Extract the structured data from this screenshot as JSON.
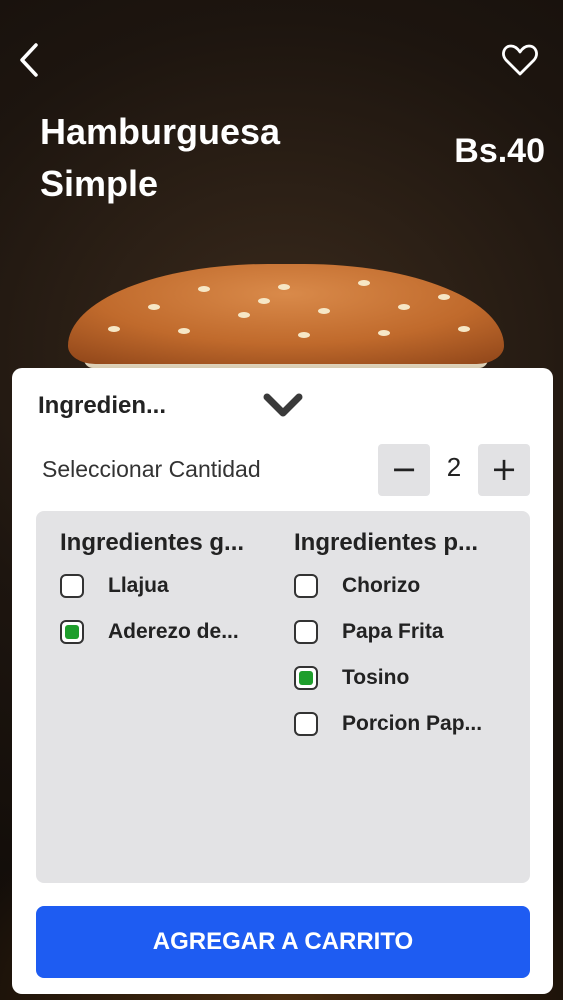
{
  "header": {
    "title_line1": "Hamburguesa",
    "title_line2": "Simple",
    "price": "Bs.40",
    "back_icon": "chevron-left-icon",
    "favorite_icon": "heart-icon"
  },
  "panel": {
    "section_title": "Ingredien...",
    "collapse_icon": "chevron-down-icon",
    "quantity_label": "Seleccionar Cantidad",
    "quantity_value": "2",
    "minus_label": "−",
    "plus_label": "+",
    "columns": [
      {
        "header": "Ingredientes g...",
        "items": [
          {
            "label": "Llajua",
            "checked": false
          },
          {
            "label": "Aderezo de...",
            "checked": true
          }
        ]
      },
      {
        "header": "Ingredientes p...",
        "items": [
          {
            "label": "Chorizo",
            "checked": false
          },
          {
            "label": "Papa Frita",
            "checked": false
          },
          {
            "label": "Tosino",
            "checked": true
          },
          {
            "label": "Porcion Pap...",
            "checked": false
          }
        ]
      }
    ],
    "add_button": "AGREGAR A CARRITO"
  },
  "colors": {
    "accent": "#1e5cf2",
    "checked": "#1e9e2c",
    "panel_inner": "#e3e3e5"
  }
}
